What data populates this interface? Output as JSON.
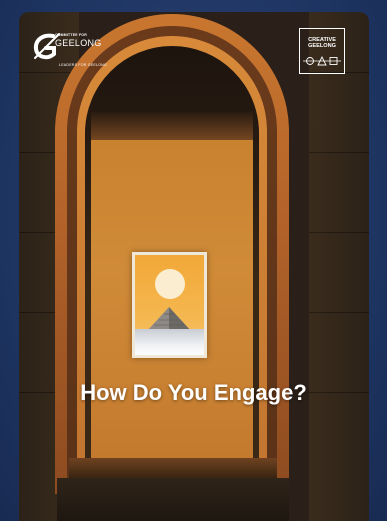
{
  "logos": {
    "left": {
      "small_text": "COMMITTEE FOR",
      "main_text": "GEELONG",
      "sub_text": "LEADERS FOR GEELONG",
      "icon": "g-swoosh-icon"
    },
    "right": {
      "text": "CREATIVE\nGEELONG",
      "icon": "creative-geelong-shapes-icon"
    }
  },
  "headline": "How Do You Engage?",
  "colors": {
    "background": "#233a66",
    "arch": "#c9772f",
    "back_wall": "#d08b38",
    "text": "#ffffff"
  }
}
